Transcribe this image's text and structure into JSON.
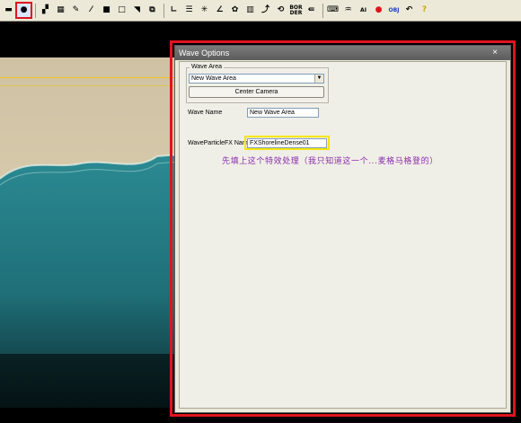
{
  "toolbar": {
    "items": [
      {
        "name": "wave-area-tool-icon",
        "glyph": "▬"
      },
      {
        "name": "wave-tool-icon",
        "glyph": "●",
        "selected": true
      },
      {
        "name": "checker-small-icon",
        "glyph": "▞"
      },
      {
        "name": "checker-large-icon",
        "glyph": "▦"
      },
      {
        "name": "eyedropper-icon",
        "glyph": "✎"
      },
      {
        "name": "brush-icon",
        "glyph": "⁄"
      },
      {
        "name": "square-fill-icon",
        "glyph": "■"
      },
      {
        "name": "square-outline-icon",
        "glyph": "□"
      },
      {
        "name": "corner-icon",
        "glyph": "◥"
      },
      {
        "name": "copy-icon",
        "glyph": "⧉"
      },
      {
        "name": "axis-icon",
        "glyph": "∟"
      },
      {
        "name": "dashed-lines-icon",
        "glyph": "☰"
      },
      {
        "name": "tree-icon",
        "glyph": "✳"
      },
      {
        "name": "angle-icon",
        "glyph": "∠"
      },
      {
        "name": "paint-icon",
        "glyph": "✿"
      },
      {
        "name": "grid-red-icon",
        "glyph": "▥"
      },
      {
        "name": "path-icon",
        "glyph": "⤴"
      },
      {
        "name": "rotate-icon",
        "glyph": "⟲"
      },
      {
        "name": "border-icon",
        "text": "BOR DER"
      },
      {
        "name": "arrows-icon",
        "glyph": "⇚"
      },
      {
        "name": "keyboard-icon",
        "glyph": "⌨"
      },
      {
        "name": "grass-icon",
        "glyph": "♒"
      },
      {
        "name": "ai-icon",
        "text": "AI"
      },
      {
        "name": "record-icon",
        "glyph": "●",
        "color": "#e0141e"
      },
      {
        "name": "obj-icon",
        "text": "OBJ",
        "color": "#1a3cc8"
      },
      {
        "name": "undo-icon",
        "glyph": "↶"
      },
      {
        "name": "help-icon",
        "glyph": "?",
        "color": "#c8a800"
      }
    ]
  },
  "dialog": {
    "title": "Wave Options",
    "close_glyph": "×",
    "wave_area_group": "Wave Area",
    "wave_area_selected": "New Wave Area",
    "center_camera_label": "Center Camera",
    "wave_name_label": "Wave Name",
    "wave_name_value": "New Wave Area",
    "fx_name_label": "WaveParticleFX Name",
    "fx_name_value": "FXShorelineDense01"
  },
  "annotation": "先填上这个特效处理（我只知道这一个...麦格马格登的）",
  "colors": {
    "highlight_red": "#e0141e",
    "highlight_yellow": "#f5e60a",
    "annotation_purple": "#8b2cae",
    "sand": "#d8c6a0",
    "sea": "#1f6f78"
  }
}
